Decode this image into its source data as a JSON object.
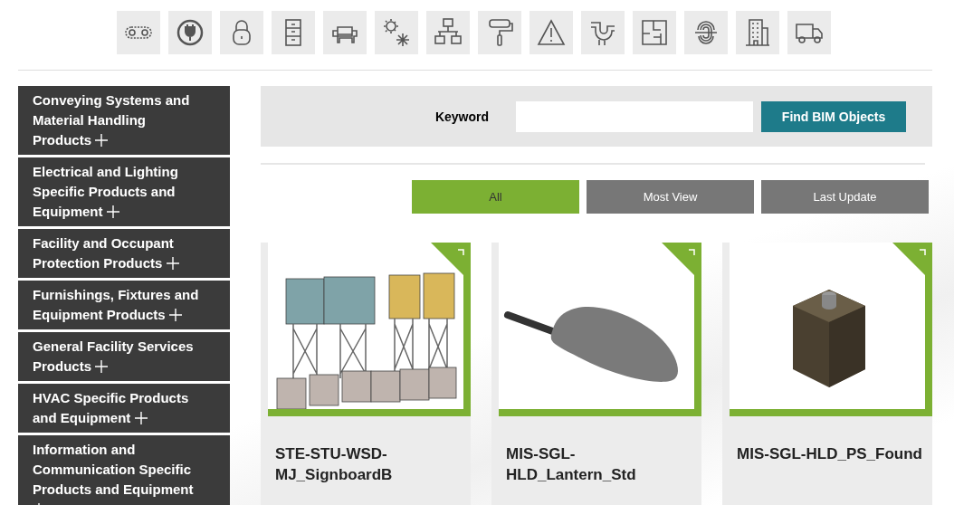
{
  "sidebar": {
    "items": [
      {
        "label": "Conveying Systems and Material Handling Products",
        "expanded": false
      },
      {
        "label": "Electrical and Lighting Specific Products and Equipment",
        "expanded": false
      },
      {
        "label": "Facility and Occupant Protection Products",
        "expanded": false
      },
      {
        "label": "Furnishings, Fixtures and Equipment Products",
        "expanded": false
      },
      {
        "label": "General Facility Services Products",
        "expanded": false
      },
      {
        "label": "HVAC Specific Products and Equipment",
        "expanded": false
      },
      {
        "label": "Information and Communication Specific Products and Equipment",
        "expanded": false
      }
    ]
  },
  "search": {
    "label": "Keyword",
    "button": "Find BIM Objects"
  },
  "filter_tabs": [
    {
      "label": "All",
      "selected": true
    },
    {
      "label": "Most View",
      "selected": false
    },
    {
      "label": "Last Update",
      "selected": false
    }
  ],
  "cards": [
    {
      "title": "STE-STU-WSD-MJ_SignboardB",
      "kind": "signboard"
    },
    {
      "title": "MIS-SGL-HLD_Lantern_Std",
      "kind": "lantern"
    },
    {
      "title": "MIS-SGL-HLD_PS_Found",
      "kind": "block"
    }
  ]
}
